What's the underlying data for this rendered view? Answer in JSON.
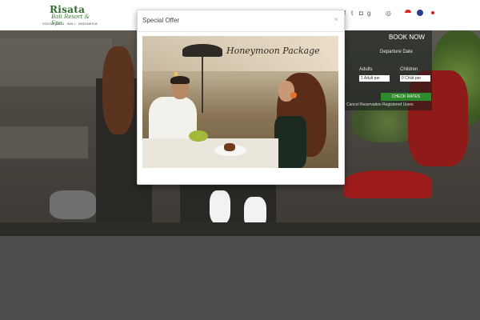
{
  "header": {
    "logo_name": "Risata",
    "logo_script": "Bali Resort & Spa",
    "logo_tagline": "SOUTH KUTA · BALI · INDONESIA",
    "social_icons": [
      "facebook-icon",
      "twitter-icon",
      "instagram-icon",
      "googleplus-icon",
      "tripadvisor-icon"
    ],
    "flags": [
      "indonesia-flag",
      "uk-flag",
      "japan-flag"
    ]
  },
  "booking": {
    "book_now": "BOOK NOW",
    "departure_label": "Departure Date",
    "adults_label": "Adults",
    "children_label": "Children",
    "adults_value": "1 Adult per",
    "children_value": "0 Child per",
    "check_rates": "CHECK RATES",
    "links_text": "Cancel Reservation  Registered Users"
  },
  "modal": {
    "title": "Special Offer",
    "close_glyph": "×",
    "promo_text": "Honeymoon Package"
  },
  "colors": {
    "brand_green": "#2e6b2e",
    "check_rates": "#2d8a2d",
    "overlay_bg": "#4d4d4d"
  }
}
